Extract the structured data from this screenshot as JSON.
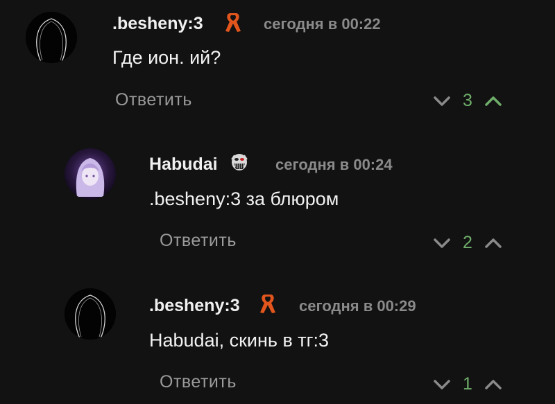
{
  "comments": [
    {
      "author": ".besheny:3",
      "badge": "orange-ribbon-icon",
      "time": "сегодня в 00:22",
      "text": "Где  ион. ий?",
      "reply_label": "Ответить",
      "score": "3"
    },
    {
      "author": "Habudai",
      "badge": "mask-icon",
      "time": "сегодня в 00:24",
      "text": ".besheny:3 за блюром",
      "reply_label": "Ответить",
      "score": "2"
    },
    {
      "author": ".besheny:3",
      "badge": "orange-ribbon-icon",
      "time": "сегодня в 00:29",
      "text": "Habudai, скинь в тг:3",
      "reply_label": "Ответить",
      "score": "1"
    }
  ],
  "colors": {
    "background": "#121212",
    "score_positive": "#6fae6a",
    "ribbon": "#e2561d",
    "muted_text": "#8a8a8a"
  }
}
